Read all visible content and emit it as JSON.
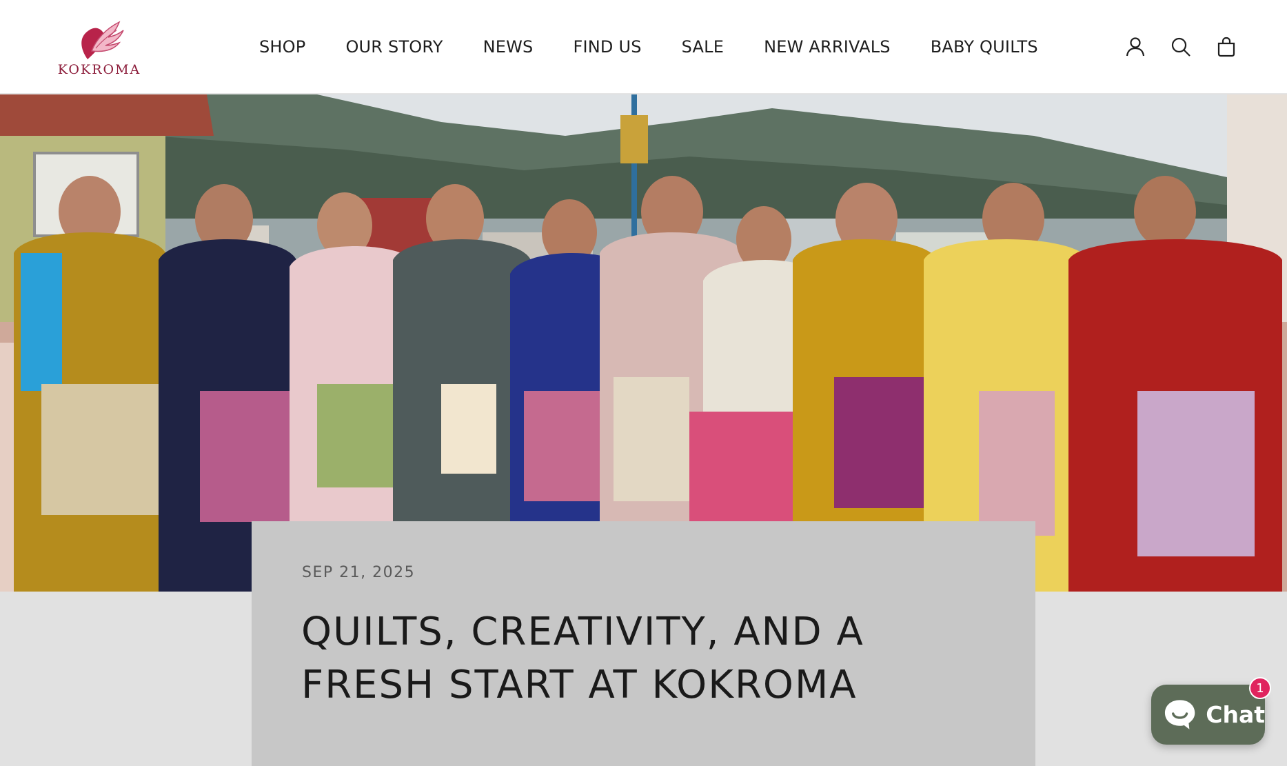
{
  "brand": {
    "name": "KOKROMA",
    "accent_color": "#8c1c3a",
    "logo_icon": "wing-icon"
  },
  "nav": {
    "items": [
      {
        "label": "SHOP"
      },
      {
        "label": "OUR STORY"
      },
      {
        "label": "NEWS"
      },
      {
        "label": "FIND US"
      },
      {
        "label": "SALE"
      },
      {
        "label": "NEW ARRIVALS"
      },
      {
        "label": "BABY QUILTS"
      }
    ]
  },
  "header_icons": {
    "account": "user-icon",
    "search": "search-icon",
    "cart": "shopping-bag-icon"
  },
  "hero": {
    "image_subject": "group-photo"
  },
  "article": {
    "date": "SEP 21, 2025",
    "title": "QUILTS, CREATIVITY, AND A FRESH START AT KOKROMA"
  },
  "chat": {
    "label": "Chat",
    "badge_count": "1",
    "button_color": "#5d6c58",
    "badge_color": "#e0245e"
  }
}
